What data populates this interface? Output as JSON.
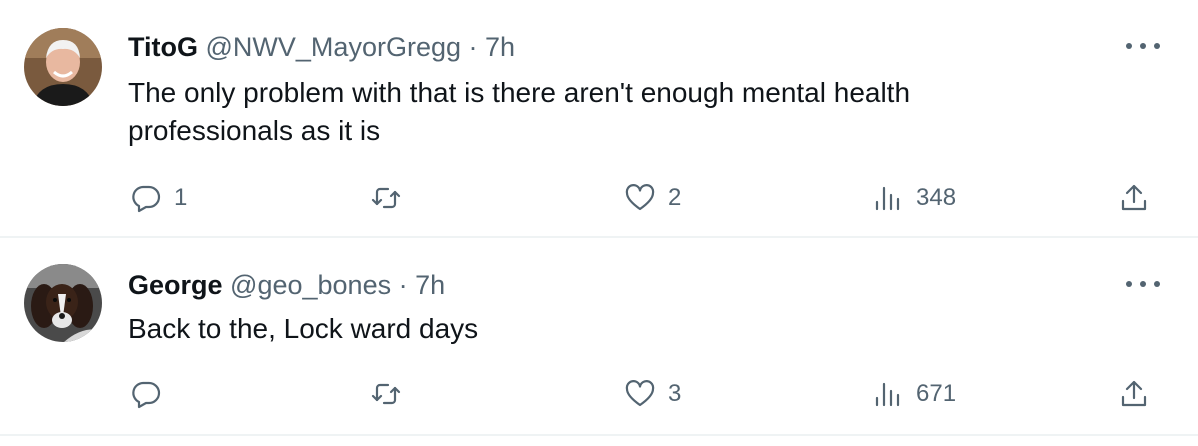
{
  "tweets": [
    {
      "name": "TitoG",
      "handle": "@NWV_MayorGregg",
      "separator": "·",
      "time": "7h",
      "text_line1": "The only problem with that is there aren't enough mental health",
      "text_line2": "professionals as it is",
      "reply_count": "1",
      "retweet_count": "",
      "like_count": "2",
      "view_count": "348",
      "avatar_icon": "person-photo-avatar"
    },
    {
      "name": "George",
      "handle": "@geo_bones",
      "separator": "·",
      "time": "7h",
      "text_line1": "Back to the, Lock ward days",
      "reply_count": "",
      "retweet_count": "",
      "like_count": "3",
      "view_count": "671",
      "avatar_icon": "dog-photo-avatar"
    }
  ],
  "icons": {
    "more": "more-dots-icon",
    "reply": "reply-bubble-icon",
    "retweet": "retweet-icon",
    "like": "heart-icon",
    "views": "views-bar-icon",
    "share": "share-upload-icon"
  },
  "colors": {
    "text": "#0f1419",
    "secondary": "#536471",
    "divider": "#eff3f4"
  }
}
